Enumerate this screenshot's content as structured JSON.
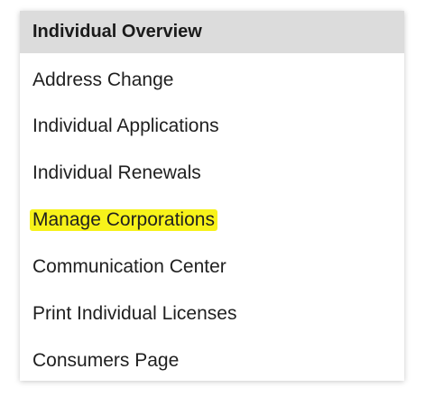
{
  "menu": {
    "header": "Individual Overview",
    "highlight_color": "#f7f21a",
    "items": [
      {
        "label": "Address Change"
      },
      {
        "label": "Individual Applications"
      },
      {
        "label": "Individual Renewals"
      },
      {
        "label": "Manage Corporations",
        "highlighted": true
      },
      {
        "label": "Communication Center"
      },
      {
        "label": "Print Individual Licenses"
      },
      {
        "label": "Consumers Page"
      }
    ]
  }
}
